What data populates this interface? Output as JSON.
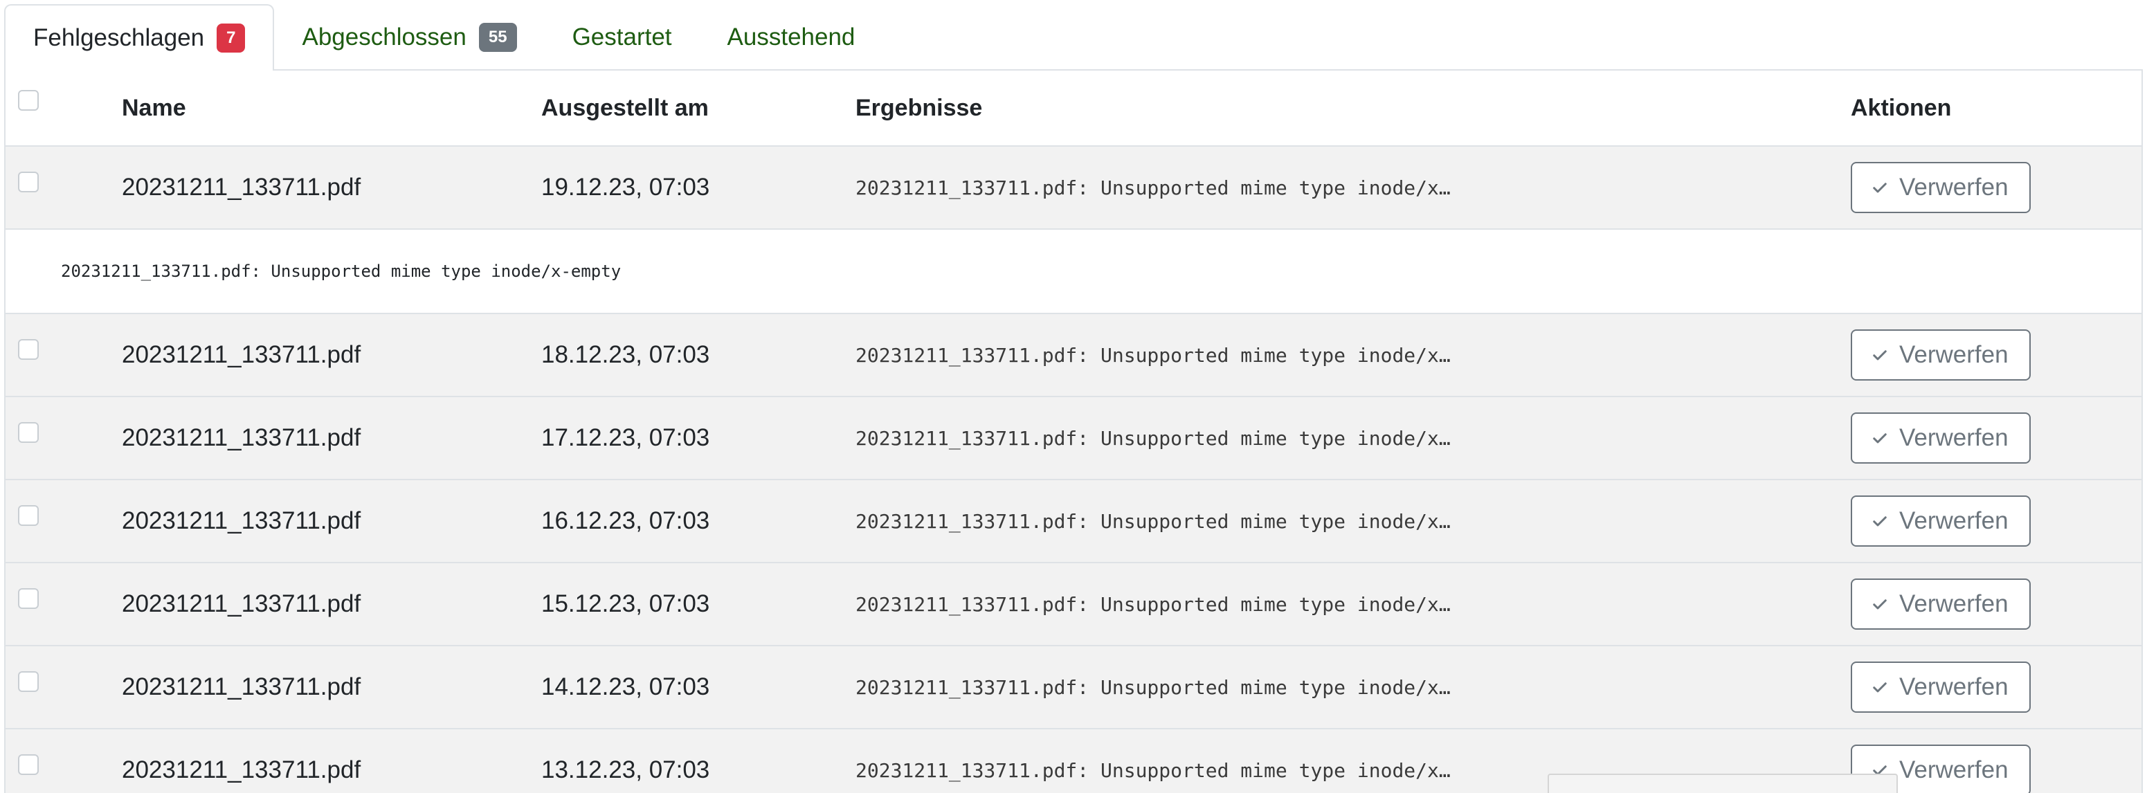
{
  "tabs": [
    {
      "label": "Fehlgeschlagen",
      "badge": "7",
      "badge_color": "#dc3545",
      "active": true
    },
    {
      "label": "Abgeschlossen",
      "badge": "55",
      "badge_color": "#6c757d",
      "active": false
    },
    {
      "label": "Gestartet",
      "active": false
    },
    {
      "label": "Ausstehend",
      "active": false
    }
  ],
  "table": {
    "columns": {
      "name": "Name",
      "issued": "Ausgestellt am",
      "results": "Ergebnisse",
      "actions": "Aktionen"
    },
    "expanded_detail": "20231211_133711.pdf: Unsupported mime type inode/x-empty",
    "rows": [
      {
        "name": "20231211_133711.pdf",
        "issued": "19.12.23, 07:03",
        "result": "20231211_133711.pdf: Unsupported mime type inode/x…",
        "action": "Verwerfen"
      },
      {
        "name": "20231211_133711.pdf",
        "issued": "18.12.23, 07:03",
        "result": "20231211_133711.pdf: Unsupported mime type inode/x…",
        "action": "Verwerfen"
      },
      {
        "name": "20231211_133711.pdf",
        "issued": "17.12.23, 07:03",
        "result": "20231211_133711.pdf: Unsupported mime type inode/x…",
        "action": "Verwerfen"
      },
      {
        "name": "20231211_133711.pdf",
        "issued": "16.12.23, 07:03",
        "result": "20231211_133711.pdf: Unsupported mime type inode/x…",
        "action": "Verwerfen"
      },
      {
        "name": "20231211_133711.pdf",
        "issued": "15.12.23, 07:03",
        "result": "20231211_133711.pdf: Unsupported mime type inode/x…",
        "action": "Verwerfen"
      },
      {
        "name": "20231211_133711.pdf",
        "issued": "14.12.23, 07:03",
        "result": "20231211_133711.pdf: Unsupported mime type inode/x…",
        "action": "Verwerfen"
      },
      {
        "name": "20231211_133711.pdf",
        "issued": "13.12.23, 07:03",
        "result": "20231211_133711.pdf: Unsupported mime type inode/x…",
        "action": "Verwerfen"
      }
    ]
  },
  "icons": {
    "action_button_icon": "check-icon"
  },
  "colors": {
    "tab_link": "#1e5c12",
    "row_background": "#f2f2f2",
    "button_outline": "#6c757d"
  }
}
